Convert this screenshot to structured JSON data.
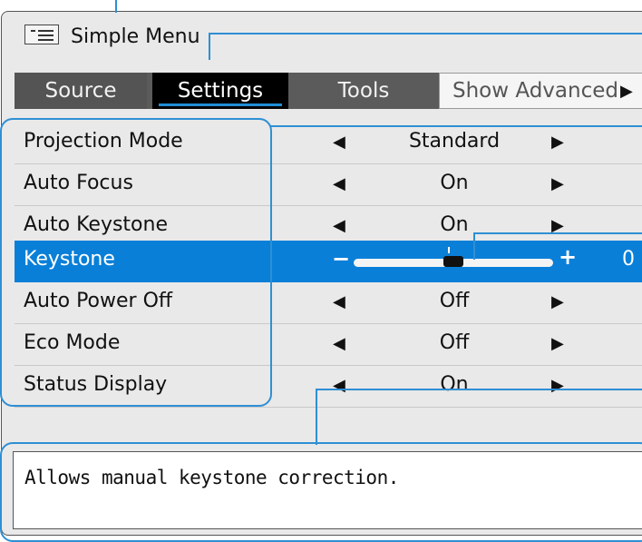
{
  "window": {
    "title": "Simple Menu",
    "title_icon": "menu-list-icon"
  },
  "tabs": [
    {
      "label": "Source",
      "selected": false
    },
    {
      "label": "Settings",
      "selected": true
    },
    {
      "label": "Tools",
      "selected": false
    }
  ],
  "advanced_button": {
    "label": "Show Advanced",
    "icon": "triangle-right-icon"
  },
  "settings": [
    {
      "label": "Projection Mode",
      "value": "Standard"
    },
    {
      "label": "Auto Focus",
      "value": "On"
    },
    {
      "label": "Auto Keystone",
      "value": "On"
    },
    {
      "label": "Keystone",
      "type": "slider",
      "value": "0",
      "slider_level": 0.5,
      "selected": true
    },
    {
      "label": "Auto Power Off",
      "value": "Off"
    },
    {
      "label": "Eco Mode",
      "value": "Off"
    },
    {
      "label": "Status Display",
      "value": "On"
    }
  ],
  "description": "Allows manual keystone correction.",
  "colors": {
    "selection": "#0a7fd8",
    "callout": "#2f8fd4",
    "tab_bar": "#5b5b5b"
  }
}
